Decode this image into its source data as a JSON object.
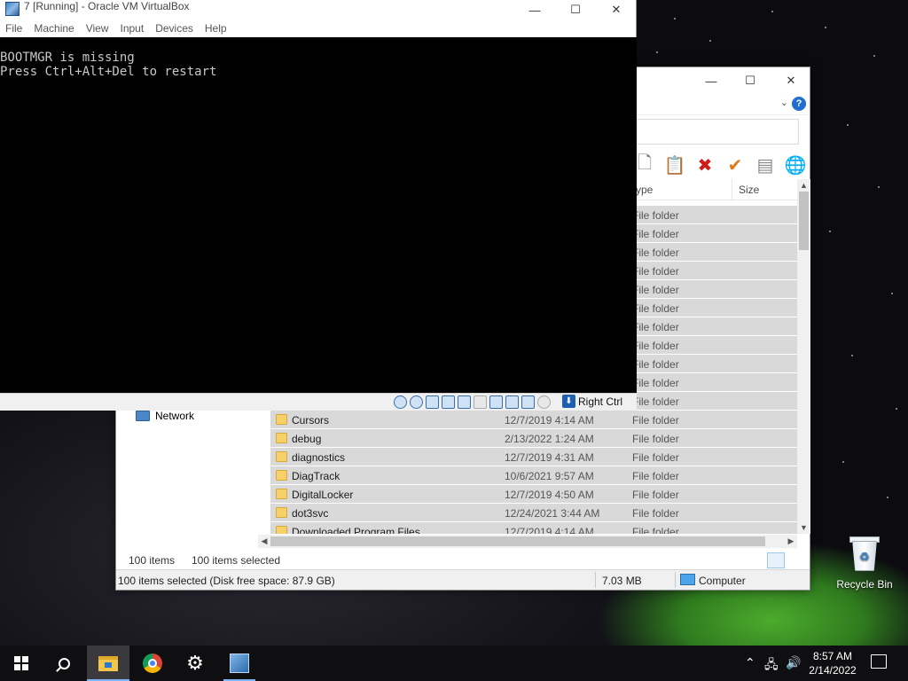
{
  "virtualbox": {
    "title": "7 [Running] - Oracle VM VirtualBox",
    "menu": [
      "File",
      "Machine",
      "View",
      "Input",
      "Devices",
      "Help"
    ],
    "console_lines": [
      "BOOTMGR is missing",
      "Press Ctrl+Alt+Del to restart"
    ],
    "host_key": "Right Ctrl"
  },
  "explorer": {
    "columns": {
      "type": "ype",
      "size": "Size"
    },
    "hidden_rows_type": "File folder",
    "visible_rows": [
      {
        "name": "Cursors",
        "date": "12/7/2019 4:14 AM",
        "type": "File folder"
      },
      {
        "name": "debug",
        "date": "2/13/2022 1:24 AM",
        "type": "File folder"
      },
      {
        "name": "diagnostics",
        "date": "12/7/2019 4:31 AM",
        "type": "File folder"
      },
      {
        "name": "DiagTrack",
        "date": "10/6/2021 9:57 AM",
        "type": "File folder"
      },
      {
        "name": "DigitalLocker",
        "date": "12/7/2019 4:50 AM",
        "type": "File folder"
      },
      {
        "name": "dot3svc",
        "date": "12/24/2021 3:44 AM",
        "type": "File folder"
      },
      {
        "name": "Downloaded Program Files",
        "date": "12/7/2019 4:14 AM",
        "type": "File folder"
      }
    ],
    "nav_network": "Network",
    "status_items": "100 items",
    "status_selected": "100 items selected",
    "status_bar_text": "100 items selected (Disk free space: 87.9 GB)",
    "status_size": "7.03 MB",
    "status_location": "Computer"
  },
  "desktop": {
    "recycle_bin_label": "Recycle Bin"
  },
  "taskbar": {
    "time": "8:57 AM",
    "date": "2/14/2022"
  }
}
